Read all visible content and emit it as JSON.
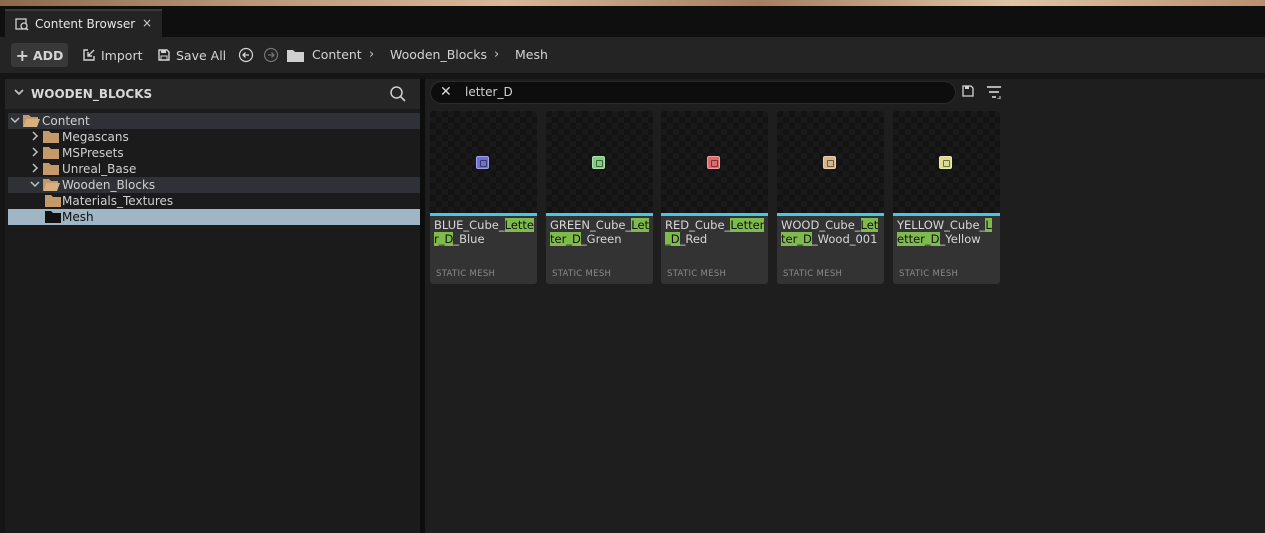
{
  "window": {
    "tab_title": "Content Browser",
    "close_glyph": "×"
  },
  "toolbar": {
    "add_label": "ADD",
    "import_label": "Import",
    "saveall_label": "Save All",
    "breadcrumb": [
      "Content",
      "Wooden_Blocks",
      "Mesh"
    ],
    "breadcrumb_separator": "›"
  },
  "sidebar": {
    "title": "WOODEN_BLOCKS",
    "tree": [
      {
        "label": "Content",
        "state": "expanded",
        "level": 0,
        "selected": "dark"
      },
      {
        "label": "Megascans",
        "state": "collapsed",
        "level": 1,
        "selected": "none"
      },
      {
        "label": "MSPresets",
        "state": "collapsed",
        "level": 1,
        "selected": "none"
      },
      {
        "label": "Unreal_Base",
        "state": "collapsed",
        "level": 1,
        "selected": "none"
      },
      {
        "label": "Wooden_Blocks",
        "state": "expanded",
        "level": 1,
        "selected": "dark"
      },
      {
        "label": "Materials_Textures",
        "state": "leaf",
        "level": 2,
        "selected": "none"
      },
      {
        "label": "Mesh",
        "state": "leaf",
        "level": 2,
        "selected": "light"
      }
    ]
  },
  "search": {
    "query": "letter_D",
    "clear_glyph": "✕"
  },
  "assets": [
    {
      "name_lines": [
        [
          "BLUE_Cube_",
          ""
        ],
        [
          "",
          ""
        ]
      ],
      "type": "STATIC MESH",
      "cube_color": "#6f6fd8"
    },
    {
      "name_lines": [],
      "type": "STATIC MESH",
      "cube_color": "#7fcf7f"
    },
    {
      "name_lines": [],
      "type": "STATIC MESH",
      "cube_color": "#e06a6a"
    },
    {
      "name_lines": [],
      "type": "STATIC MESH",
      "cube_color": "#d8b48c"
    },
    {
      "name_lines": [],
      "type": "STATIC MESH",
      "cube_color": "#dedc8e"
    }
  ],
  "asset_names": [
    {
      "pre": "BLUE_Cube_",
      "hl": "Letter_D",
      "post": "_Blue"
    },
    {
      "pre": "GREEN_Cube_",
      "hl": "Letter_D",
      "post": "_Green"
    },
    {
      "pre": "RED_Cube_",
      "hl": "Letter_D",
      "post": "_Red"
    },
    {
      "pre": "WOOD_Cube_",
      "hl": "Letter_D",
      "post": "_Wood_001"
    },
    {
      "pre": "YELLOW_Cube_",
      "hl": "Letter_D",
      "post": "_Yellow"
    }
  ],
  "colors": {
    "accent": "#45c8e6",
    "highlight": "#7fbb4c",
    "selection": "#a0b6c4"
  }
}
